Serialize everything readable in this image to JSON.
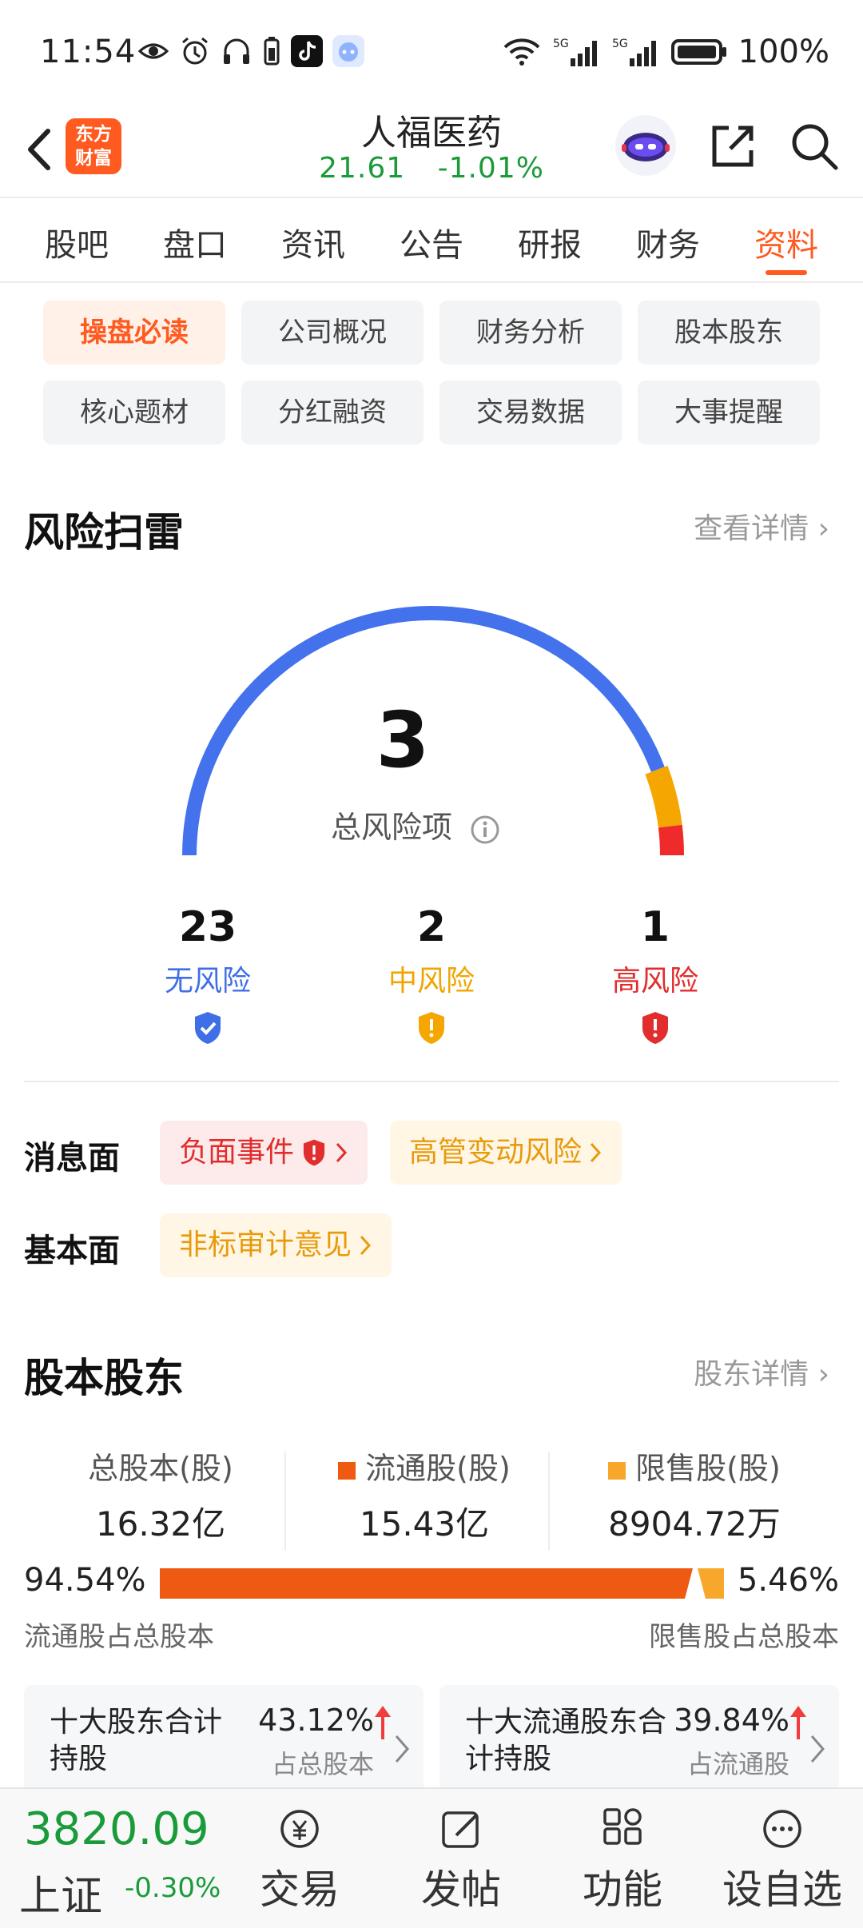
{
  "status_bar": {
    "time": "11:54",
    "battery": "100%",
    "network": "5G"
  },
  "header": {
    "logo_text": "东方\n财富",
    "logo_line1": "东方",
    "logo_line2": "财富",
    "stock_name": "人福医药",
    "price": "21.61",
    "change_pct": "-1.01%"
  },
  "tabs": [
    "股吧",
    "盘口",
    "资讯",
    "公告",
    "研报",
    "财务",
    "资料"
  ],
  "active_tab": "资料",
  "sub_tabs": [
    "操盘必读",
    "公司概况",
    "财务分析",
    "股本股东",
    "核心题材",
    "分红融资",
    "交易数据",
    "大事提醒"
  ],
  "active_sub_tab": "操盘必读",
  "risk": {
    "section_title": "风险扫雷",
    "detail_link": "查看详情 ›",
    "total": "3",
    "total_label": "总风险项",
    "gauge_shares": {
      "none": 23,
      "medium": 2,
      "high": 1
    },
    "levels": [
      {
        "count": "23",
        "name": "无风险",
        "color": "#3f6fe6"
      },
      {
        "count": "2",
        "name": "中风险",
        "color": "#f0a500"
      },
      {
        "count": "1",
        "name": "高风险",
        "color": "#e12d2d"
      }
    ],
    "news_label": "消息面",
    "news_tags": [
      "负面事件",
      "高管变动风险"
    ],
    "fundamental_label": "基本面",
    "fundamental_tags": [
      "非标审计意见"
    ]
  },
  "equity": {
    "section_title": "股本股东",
    "detail_link": "股东详情 ›",
    "columns": [
      {
        "label": "总股本(股)",
        "value": "16.32亿"
      },
      {
        "label": "流通股(股)",
        "value": "15.43亿"
      },
      {
        "label": "限售股(股)",
        "value": "8904.72万"
      }
    ],
    "float_pct": "94.54%",
    "restricted_pct": "5.46%",
    "float_share": 0.9454,
    "float_caption": "流通股占总股本",
    "restricted_caption": "限售股占总股本",
    "colors": {
      "float": "#ee5a12",
      "restricted": "#f7a82c"
    },
    "holders": [
      {
        "title": "十大股东合计持股",
        "pct": "43.12%",
        "sub": "占总股本"
      },
      {
        "title": "十大流通股东合计持股",
        "pct": "39.84%",
        "sub": "占流通股"
      }
    ]
  },
  "bottom_bar": {
    "index_value": "3820.09",
    "index_name": "上证",
    "index_change": "-0.30%",
    "nav": [
      "交易",
      "发帖",
      "功能",
      "设自选"
    ]
  }
}
